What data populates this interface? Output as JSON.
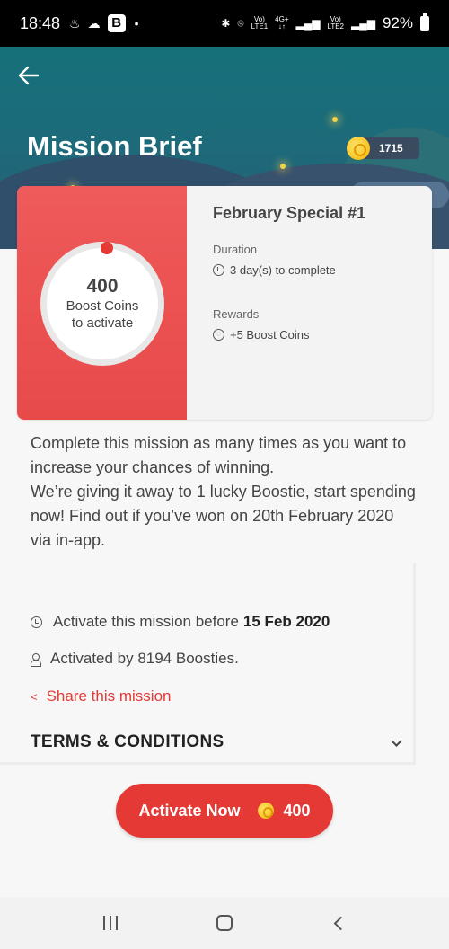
{
  "status_bar": {
    "time": "18:48",
    "signal_1_top": "Vo)",
    "signal_1_bottom": "LTE1",
    "network_top": "4G+",
    "signal_2_top": "Vo)",
    "signal_2_bottom": "LTE2",
    "battery_percent": "92%"
  },
  "header": {
    "title": "Mission Brief",
    "coin_balance": "1715"
  },
  "mission": {
    "name": "February Special #1",
    "cost_amount": "400",
    "cost_label_line1": "Boost Coins",
    "cost_label_line2": "to activate",
    "duration_label": "Duration",
    "duration_value": "3 day(s) to complete",
    "rewards_label": "Rewards",
    "rewards_value": "+5 Boost Coins"
  },
  "description": {
    "paragraph_1": "Complete this mission as many times as you want to increase your chances of winning.",
    "paragraph_2": "We’re giving it away to 1 lucky Boostie, start spending now! Find out if you’ve won on 20th February 2020 via in-app."
  },
  "info": {
    "activate_before_text": "Activate this mission before",
    "activate_before_date": "15 Feb 2020",
    "activated_by_text": "Activated by 8194 Boosties.",
    "share_label": "Share this mission",
    "terms_label": "TERMS & CONDITIONS"
  },
  "activate_button": {
    "label": "Activate Now",
    "amount": "400"
  },
  "colors": {
    "accent_red": "#e53935",
    "card_red": "#ef5a5a",
    "header_teal": "#16707a",
    "coin_gold": "#f4b400"
  },
  "icons": [
    "back-arrow-icon",
    "coin-icon",
    "clock-icon",
    "person-icon",
    "share-icon",
    "chevron-down-icon",
    "recents-icon",
    "home-icon",
    "nav-back-icon"
  ]
}
